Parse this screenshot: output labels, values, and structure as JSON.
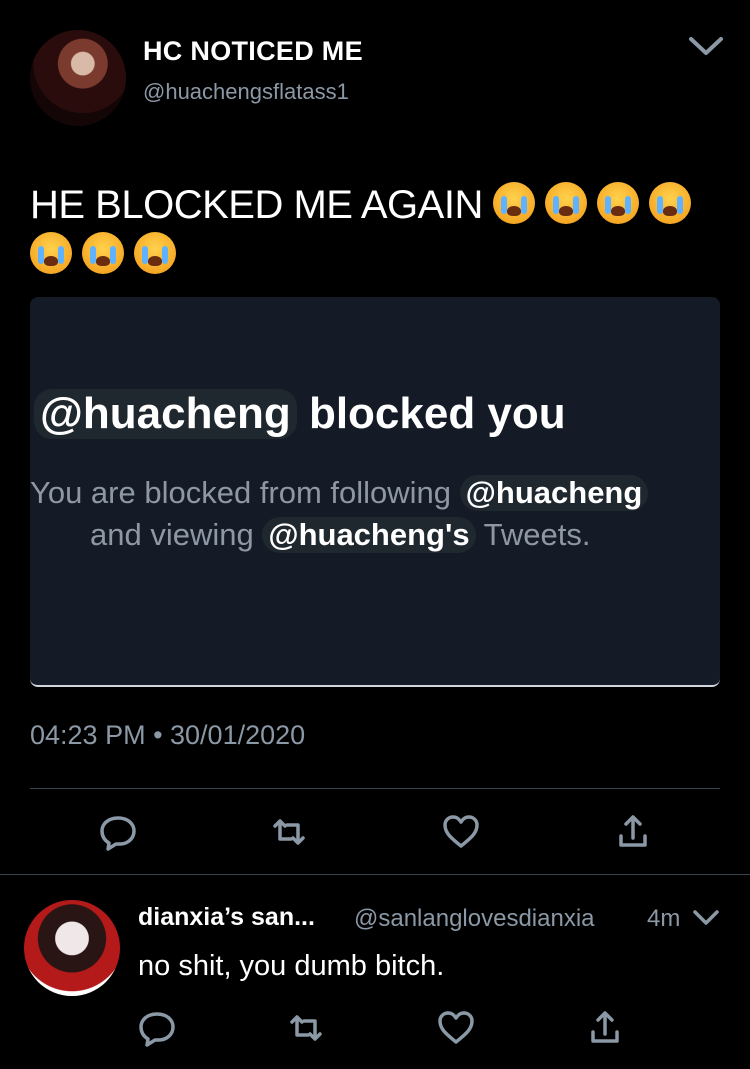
{
  "tweet": {
    "display_name": "HC NOTICED ME",
    "handle": "@huachengsflatass1",
    "text": "HE BLOCKED ME AGAIN",
    "emoji": "😭",
    "emoji_count": 7,
    "timestamp": "04:23 PM • 30/01/2020"
  },
  "media": {
    "mention": "@huacheng",
    "title_rest": "blocked you",
    "line1_prefix": "You are blocked from following",
    "line1_mention": "@huacheng",
    "line2_prefix": "and viewing",
    "line2_mention": "@huacheng's",
    "line2_suffix": "Tweets."
  },
  "reply": {
    "display_name": "dianxia’s san...",
    "handle": "@sanlanglovesdianxia",
    "time": "4m",
    "text": "no shit, you dumb bitch."
  },
  "icons": [
    "reply-icon",
    "retweet-icon",
    "like-icon",
    "share-icon",
    "chevron-down-icon"
  ],
  "colors": {
    "background": "#000000",
    "secondary_text": "#8b98a5",
    "divider": "#38444d",
    "card_bg": "#141b26"
  }
}
